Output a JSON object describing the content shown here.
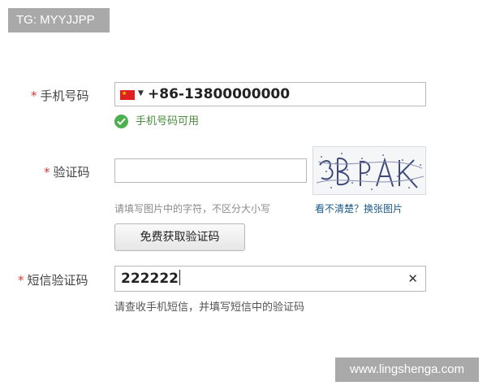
{
  "watermarks": {
    "top_left": "TG: MYYJJPP",
    "bottom_right": "www.lingshenga.com"
  },
  "required_mark": "*",
  "phone": {
    "label": "手机号码",
    "country_code_value": "+86-13800000000",
    "flag_icon": "china-flag-icon",
    "status_text": "手机号码可用",
    "status_color": "#4caf50"
  },
  "captcha": {
    "label": "验证码",
    "value": "",
    "image_text": "3PAK",
    "hint": "请填写图片中的字符，不区分大小写",
    "refresh_link": "看不清楚？换张图片"
  },
  "get_code_button": {
    "label": "免费获取验证码"
  },
  "sms": {
    "label": "短信验证码",
    "value": "222222",
    "hint": "请查收手机短信，并填写短信中的验证码",
    "clear_icon": "close-icon"
  },
  "colors": {
    "required_star": "#d23c3c",
    "link": "#1b5a8a",
    "badge_bg": "#a9a9a9"
  }
}
